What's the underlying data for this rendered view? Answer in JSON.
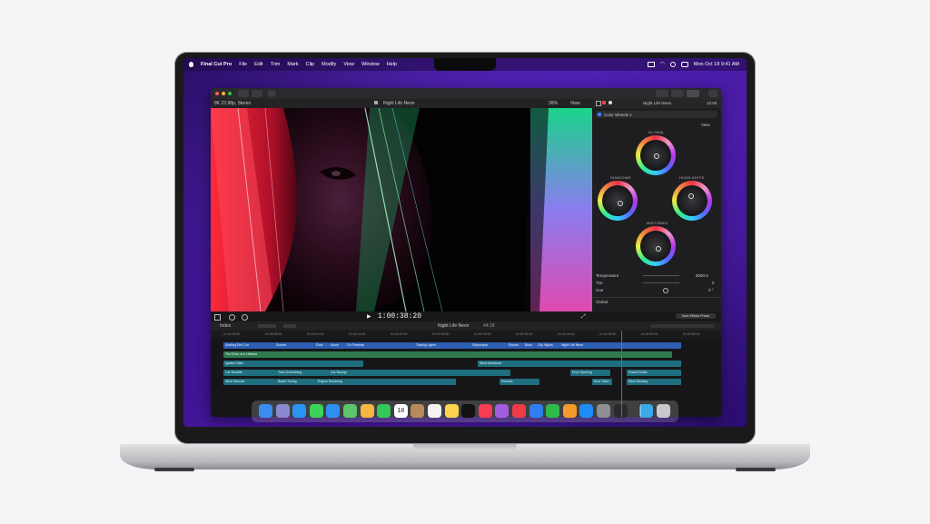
{
  "menubar": {
    "app_name": "Final Cut Pro",
    "menus": [
      "File",
      "Edit",
      "Trim",
      "Mark",
      "Clip",
      "Modify",
      "View",
      "Window",
      "Help"
    ],
    "clock": "Mon Oct 18  9:41 AM"
  },
  "viewer": {
    "format": "8K 23.98p, Stereo",
    "title": "Night Life Neon",
    "zoom": "26%",
    "view_label": "View",
    "timecode": "1:00:38:20"
  },
  "inspector": {
    "header_title": "Night Life Neon",
    "header_time": "12:00",
    "effect_name": "Color Wheels 1",
    "view_label": "View",
    "wheels": [
      "GLOBAL",
      "SHADOWS",
      "HIGHLIGHTS",
      "MIDTONES"
    ],
    "params": [
      {
        "label": "Temperature",
        "value": "5000.0"
      },
      {
        "label": "Tint",
        "value": "0"
      },
      {
        "label": "Hue",
        "value": "0 °"
      }
    ],
    "section_global": "Global",
    "save_preset_label": "Save Effects Preset"
  },
  "timeline": {
    "index_label": "Index",
    "project_title": "Night Life Neon",
    "duration": "44:18",
    "ruler_ticks": [
      "01:00:00:00",
      "01:00:05:00",
      "01:00:10:00",
      "01:00:15:00",
      "01:00:20:00",
      "01:00:25:00",
      "01:00:30:00",
      "01:00:35:00",
      "01:00:40:00",
      "01:00:45:00",
      "01:00:50:00",
      "01:00:55:00"
    ],
    "clips": [
      {
        "label": "Starting Dev Car",
        "color": "#2f5fb3",
        "row": 0,
        "start": 14,
        "width": 56
      },
      {
        "label": "Sunset",
        "color": "#2f5fb3",
        "row": 0,
        "start": 70,
        "width": 44
      },
      {
        "label": "Exits",
        "color": "#2f5fb3",
        "row": 0,
        "start": 114,
        "width": 16
      },
      {
        "label": "Alone",
        "color": "#2f5fb3",
        "row": 0,
        "start": 130,
        "width": 18
      },
      {
        "label": "On Freeway",
        "color": "#2f5fb3",
        "row": 0,
        "start": 148,
        "width": 76
      },
      {
        "label": "Trading Lights",
        "color": "#2f5fb3",
        "row": 0,
        "start": 224,
        "width": 62
      },
      {
        "label": "Skyscraper",
        "color": "#2f5fb3",
        "row": 0,
        "start": 286,
        "width": 40
      },
      {
        "label": "Rocket",
        "color": "#2f5fb3",
        "row": 0,
        "start": 326,
        "width": 18
      },
      {
        "label": "Birds",
        "color": "#2f5fb3",
        "row": 0,
        "start": 344,
        "width": 14
      },
      {
        "label": "City Nights",
        "color": "#2f5fb3",
        "row": 0,
        "start": 358,
        "width": 26
      },
      {
        "label": "Night Life Neon",
        "color": "#2f5fb3",
        "row": 0,
        "start": 384,
        "width": 134
      },
      {
        "label": "The Drive of a Lifetime",
        "color": "#2e7a4f",
        "row": 1,
        "start": 14,
        "width": 494
      },
      {
        "label": "Ignition Start",
        "color": "#1f6f80",
        "row": 2,
        "start": 14,
        "width": 154
      },
      {
        "label": "Wind Ambiance",
        "color": "#1f6f80",
        "row": 2,
        "start": 294,
        "width": 224
      },
      {
        "label": "Car Rumble",
        "color": "#1f6f80",
        "row": 3,
        "start": 14,
        "width": 58
      },
      {
        "label": "Tires Screeching",
        "color": "#1f6f80",
        "row": 3,
        "start": 72,
        "width": 58
      },
      {
        "label": "Car Racing",
        "color": "#1f6f80",
        "row": 3,
        "start": 130,
        "width": 200
      },
      {
        "label": "Door Opening",
        "color": "#1f6f80",
        "row": 3,
        "start": 396,
        "width": 44
      },
      {
        "label": "Gravel Radio",
        "color": "#1f6f80",
        "row": 3,
        "start": 458,
        "width": 60
      },
      {
        "label": "Wind Swoosh",
        "color": "#1f6f80",
        "row": 4,
        "start": 14,
        "width": 58
      },
      {
        "label": "Brake Tuning",
        "color": "#1f6f80",
        "row": 4,
        "start": 72,
        "width": 44
      },
      {
        "label": "Engine Rumbling",
        "color": "#1f6f80",
        "row": 4,
        "start": 116,
        "width": 154
      },
      {
        "label": "Swoosh",
        "color": "#1f6f80",
        "row": 4,
        "start": 318,
        "width": 44
      },
      {
        "label": "Door Slam",
        "color": "#1f6f80",
        "row": 4,
        "start": 420,
        "width": 22
      },
      {
        "label": "Wind Blowing",
        "color": "#1f6f80",
        "row": 4,
        "start": 458,
        "width": 60
      }
    ]
  },
  "dock": {
    "icons": [
      {
        "name": "finder-icon",
        "color": "#3b8cf0"
      },
      {
        "name": "launchpad-icon",
        "color": "#8a8ad0"
      },
      {
        "name": "safari-icon",
        "color": "#2a93f5"
      },
      {
        "name": "messages-icon",
        "color": "#3cd35a"
      },
      {
        "name": "mail-icon",
        "color": "#2f8ff0"
      },
      {
        "name": "maps-icon",
        "color": "#5cc46a"
      },
      {
        "name": "photos-icon",
        "color": "#f4b743"
      },
      {
        "name": "facetime-icon",
        "color": "#34c759"
      },
      {
        "name": "calendar-icon",
        "color": "#ffffff"
      },
      {
        "name": "contacts-icon",
        "color": "#b78a5a"
      },
      {
        "name": "reminders-icon",
        "color": "#f2f2f2"
      },
      {
        "name": "notes-icon",
        "color": "#fcd34d"
      },
      {
        "name": "tv-icon",
        "color": "#111111"
      },
      {
        "name": "music-icon",
        "color": "#fa3c55"
      },
      {
        "name": "podcasts-icon",
        "color": "#a45ce0"
      },
      {
        "name": "news-icon",
        "color": "#f03c47"
      },
      {
        "name": "keynote-icon",
        "color": "#2f7ff0"
      },
      {
        "name": "numbers-icon",
        "color": "#2fba4b"
      },
      {
        "name": "pages-icon",
        "color": "#f39a2c"
      },
      {
        "name": "app-store-icon",
        "color": "#1d8cf8"
      },
      {
        "name": "system-preferences-icon",
        "color": "#8e8e93"
      },
      {
        "name": "final-cut-pro-icon",
        "color": "#2a2a2e"
      },
      {
        "name": "downloads-folder-icon",
        "color": "#3ba8e8"
      },
      {
        "name": "trash-icon",
        "color": "#c8c8cc"
      }
    ],
    "calendar_day": "18"
  }
}
